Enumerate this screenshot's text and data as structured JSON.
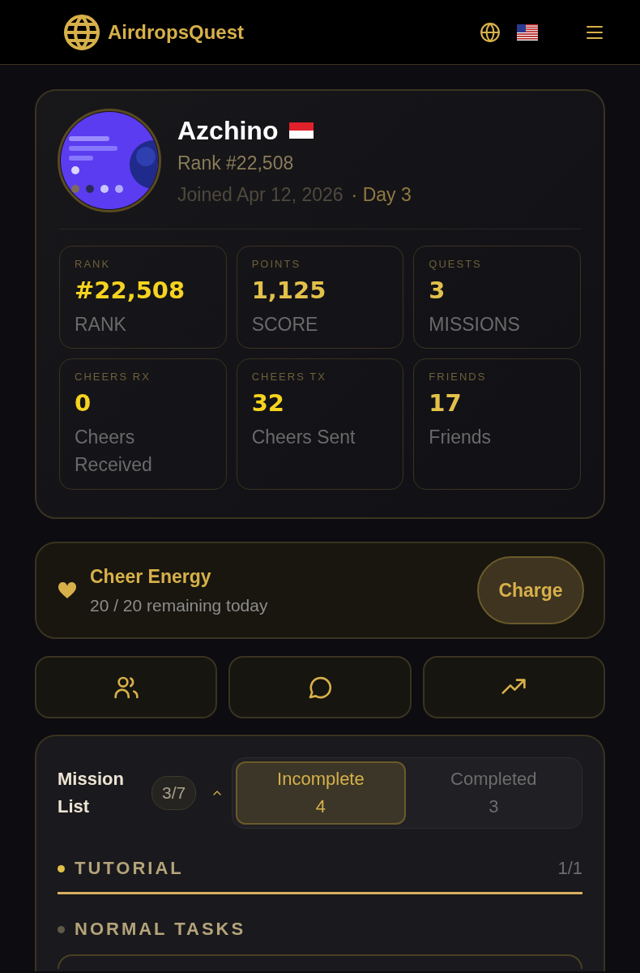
{
  "header": {
    "brand": "AirdropsQuest"
  },
  "profile": {
    "name": "Azchino",
    "rank": "Rank #22,508",
    "joined": "Joined Apr 12, 2026",
    "day": "· Day 3"
  },
  "stats": [
    {
      "label": "RANK",
      "value": "#22,508",
      "caption": "RANK",
      "color": "#f5d320"
    },
    {
      "label": "POINTS",
      "value": "1,125",
      "caption": "SCORE",
      "color": "#e2c04a"
    },
    {
      "label": "QUESTS",
      "value": "3",
      "caption": "MISSIONS",
      "color": "#e2c04a"
    },
    {
      "label": "CHEERS RX",
      "value": "0",
      "caption": "Cheers Received",
      "color": "#f5d320"
    },
    {
      "label": "CHEERS TX",
      "value": "32",
      "caption": "Cheers Sent",
      "color": "#f5d320"
    },
    {
      "label": "FRIENDS",
      "value": "17",
      "caption": "Friends",
      "color": "#e2c04a"
    }
  ],
  "energy": {
    "title": "Cheer Energy",
    "remaining": "20 / 20 remaining today",
    "button": "Charge"
  },
  "actions": [
    {
      "kind": "friends"
    },
    {
      "kind": "chat"
    },
    {
      "kind": "trend"
    }
  ],
  "missions": {
    "title": "Mission List",
    "count": "3/7",
    "expanded": true,
    "tabs": [
      {
        "label": "Incomplete",
        "count": "4",
        "selected": true
      },
      {
        "label": "Completed",
        "count": "3",
        "selected": false
      }
    ],
    "sections": [
      {
        "title": "TUTORIAL",
        "color": "#e2c04a",
        "progress": "1/1",
        "level": 1
      },
      {
        "title": "NORMAL TASKS",
        "color": "#5e5a48"
      }
    ]
  }
}
